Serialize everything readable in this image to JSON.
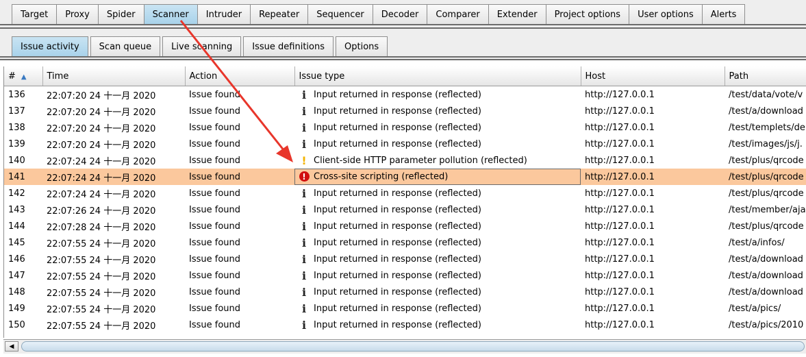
{
  "top_tabs": [
    "Target",
    "Proxy",
    "Spider",
    "Scanner",
    "Intruder",
    "Repeater",
    "Sequencer",
    "Decoder",
    "Comparer",
    "Extender",
    "Project options",
    "User options",
    "Alerts"
  ],
  "top_active": "Scanner",
  "sub_tabs": [
    "Issue activity",
    "Scan queue",
    "Live scanning",
    "Issue definitions",
    "Options"
  ],
  "sub_active": "Issue activity",
  "columns": {
    "num": "#",
    "time": "Time",
    "action": "Action",
    "issue_type": "Issue type",
    "host": "Host",
    "path": "Path"
  },
  "rows": [
    {
      "num": "136",
      "time": "22:07:20 24 十一月 2020",
      "action": "Issue found",
      "icon": "info",
      "issue": "Input returned in response (reflected)",
      "host": "http://127.0.0.1",
      "path": "/test/data/vote/v"
    },
    {
      "num": "137",
      "time": "22:07:20 24 十一月 2020",
      "action": "Issue found",
      "icon": "info",
      "issue": "Input returned in response (reflected)",
      "host": "http://127.0.0.1",
      "path": "/test/a/download"
    },
    {
      "num": "138",
      "time": "22:07:20 24 十一月 2020",
      "action": "Issue found",
      "icon": "info",
      "issue": "Input returned in response (reflected)",
      "host": "http://127.0.0.1",
      "path": "/test/templets/de"
    },
    {
      "num": "139",
      "time": "22:07:20 24 十一月 2020",
      "action": "Issue found",
      "icon": "info",
      "issue": "Input returned in response (reflected)",
      "host": "http://127.0.0.1",
      "path": "/test/images/js/j."
    },
    {
      "num": "140",
      "time": "22:07:24 24 十一月 2020",
      "action": "Issue found",
      "icon": "warn",
      "issue": "Client-side HTTP parameter pollution (reflected)",
      "host": "http://127.0.0.1",
      "path": "/test/plus/qrcode"
    },
    {
      "num": "141",
      "time": "22:07:24 24 十一月 2020",
      "action": "Issue found",
      "icon": "high",
      "issue": "Cross-site scripting (reflected)",
      "host": "http://127.0.0.1",
      "path": "/test/plus/qrcode",
      "selected": true
    },
    {
      "num": "142",
      "time": "22:07:24 24 十一月 2020",
      "action": "Issue found",
      "icon": "info",
      "issue": "Input returned in response (reflected)",
      "host": "http://127.0.0.1",
      "path": "/test/plus/qrcode"
    },
    {
      "num": "143",
      "time": "22:07:26 24 十一月 2020",
      "action": "Issue found",
      "icon": "info",
      "issue": "Input returned in response (reflected)",
      "host": "http://127.0.0.1",
      "path": "/test/member/aja"
    },
    {
      "num": "144",
      "time": "22:07:28 24 十一月 2020",
      "action": "Issue found",
      "icon": "info",
      "issue": "Input returned in response (reflected)",
      "host": "http://127.0.0.1",
      "path": "/test/plus/qrcode"
    },
    {
      "num": "145",
      "time": "22:07:55 24 十一月 2020",
      "action": "Issue found",
      "icon": "info",
      "issue": "Input returned in response (reflected)",
      "host": "http://127.0.0.1",
      "path": "/test/a/infos/"
    },
    {
      "num": "146",
      "time": "22:07:55 24 十一月 2020",
      "action": "Issue found",
      "icon": "info",
      "issue": "Input returned in response (reflected)",
      "host": "http://127.0.0.1",
      "path": "/test/a/download"
    },
    {
      "num": "147",
      "time": "22:07:55 24 十一月 2020",
      "action": "Issue found",
      "icon": "info",
      "issue": "Input returned in response (reflected)",
      "host": "http://127.0.0.1",
      "path": "/test/a/download"
    },
    {
      "num": "148",
      "time": "22:07:55 24 十一月 2020",
      "action": "Issue found",
      "icon": "info",
      "issue": "Input returned in response (reflected)",
      "host": "http://127.0.0.1",
      "path": "/test/a/download"
    },
    {
      "num": "149",
      "time": "22:07:55 24 十一月 2020",
      "action": "Issue found",
      "icon": "info",
      "issue": "Input returned in response (reflected)",
      "host": "http://127.0.0.1",
      "path": "/test/a/pics/"
    },
    {
      "num": "150",
      "time": "22:07:55 24 十一月 2020",
      "action": "Issue found",
      "icon": "info",
      "issue": "Input returned in response (reflected)",
      "host": "http://127.0.0.1",
      "path": "/test/a/pics/2010"
    }
  ],
  "colors": {
    "selected_row": "#fbc89d",
    "active_tab": "#a8d2ea",
    "arrow": "#e8362b",
    "high_icon": "#d10f0f",
    "warn_icon": "#f3b300"
  }
}
